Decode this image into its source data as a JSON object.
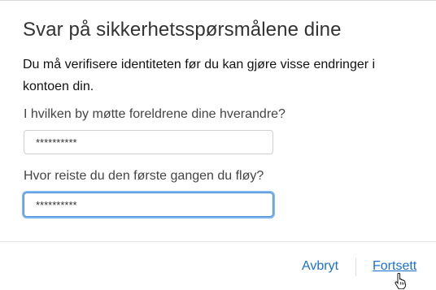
{
  "dialog": {
    "title": "Svar på sikkerhetsspørsmålene dine",
    "intro": "Du må verifisere identiteten før du kan gjøre visse endringer i kontoen din."
  },
  "questions": [
    {
      "label": "I hvilken by møtte foreldrene dine hverandre?",
      "value": "**********"
    },
    {
      "label": "Hvor reiste du den første gangen du fløy?",
      "value": "**********"
    }
  ],
  "footer": {
    "cancel_label": "Avbryt",
    "continue_label": "Fortsett"
  },
  "colors": {
    "link": "#1a6fd0",
    "focus_ring": "#7fb6ee"
  },
  "icons": {
    "cursor": "hand-pointer-icon"
  }
}
